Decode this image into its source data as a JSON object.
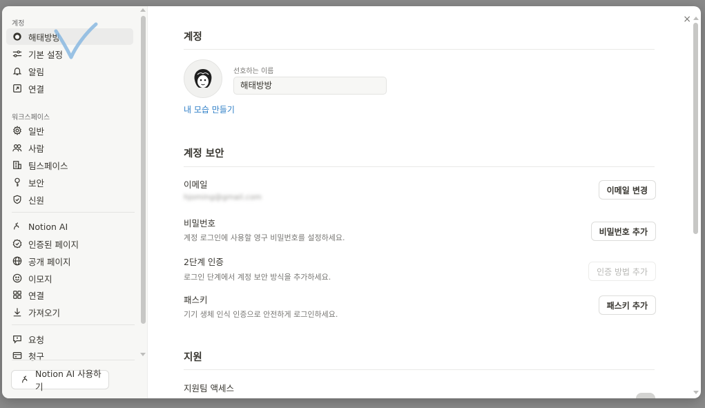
{
  "sidebar": {
    "account_section": "계정",
    "account_items": [
      {
        "label": "해태방방",
        "icon": "user-avatar-icon"
      },
      {
        "label": "기본 설정",
        "icon": "sliders-icon"
      },
      {
        "label": "알림",
        "icon": "bell-icon"
      },
      {
        "label": "연결",
        "icon": "external-link-icon"
      }
    ],
    "workspace_section": "워크스페이스",
    "workspace_items": [
      {
        "label": "일반",
        "icon": "gear-icon"
      },
      {
        "label": "사람",
        "icon": "people-icon"
      },
      {
        "label": "팀스페이스",
        "icon": "building-icon"
      },
      {
        "label": "보안",
        "icon": "key-icon"
      },
      {
        "label": "신원",
        "icon": "shield-check-icon"
      }
    ],
    "feature_items": [
      {
        "label": "Notion AI",
        "icon": "ai-face-icon"
      },
      {
        "label": "인증된 페이지",
        "icon": "verified-icon"
      },
      {
        "label": "공개 페이지",
        "icon": "globe-icon"
      },
      {
        "label": "이모지",
        "icon": "smile-icon"
      },
      {
        "label": "연결",
        "icon": "grid-icon"
      },
      {
        "label": "가져오기",
        "icon": "download-icon"
      }
    ],
    "billing_items": [
      {
        "label": "요청",
        "icon": "request-icon"
      },
      {
        "label": "청구",
        "icon": "card-icon"
      }
    ],
    "ai_button": "Notion AI 사용하기"
  },
  "main": {
    "account_title": "계정",
    "preferred_name_label": "선호하는 이름",
    "preferred_name_value": "해태방방",
    "create_avatar_link": "내 모습 만들기",
    "security_title": "계정 보안",
    "email_title": "이메일",
    "email_value": "hjoming@gmail.com",
    "email_button": "이메일 변경",
    "password_title": "비밀번호",
    "password_desc": "계정 로그인에 사용할 영구 비밀번호를 설정하세요.",
    "password_button": "비밀번호 추가",
    "twofa_title": "2단계 인증",
    "twofa_desc": "로그인 단계에서 계정 보안 방식을 추가하세요.",
    "twofa_button": "인증 방법 추가",
    "passkey_title": "패스키",
    "passkey_desc": "기기 생체 인식 인증으로 안전하게 로그인하세요.",
    "passkey_button": "패스키 추가",
    "support_title": "지원",
    "support_access_title": "지원팀 액세스",
    "close": "×"
  },
  "colors": {
    "accent_link": "#2f7fc7",
    "sidebar_bg": "#f7f7f5",
    "checkmark": "#8ab8e0"
  }
}
